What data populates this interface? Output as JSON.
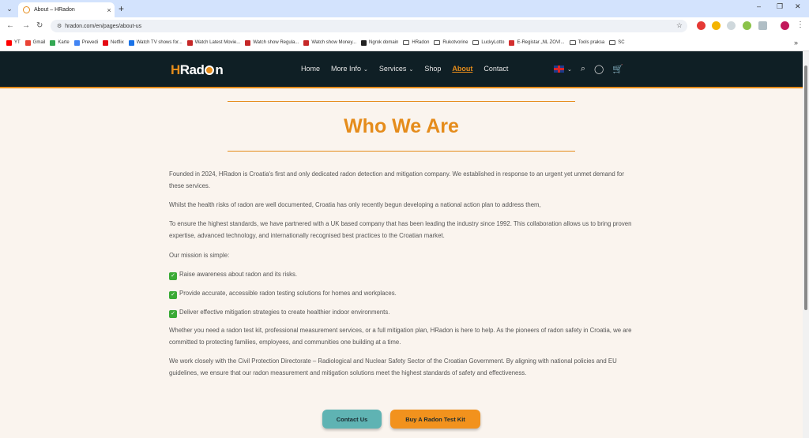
{
  "browser": {
    "tab_title": "About – HRadon",
    "new_tab": "+",
    "url": "hradon.com/en/pages/about-us",
    "window_controls": [
      "–",
      "❐",
      "✕"
    ],
    "nav": {
      "back": "←",
      "forward": "→",
      "reload": "↻"
    },
    "bookmarks": [
      {
        "label": "YT",
        "color": "#ff0000",
        "kind": "icon"
      },
      {
        "label": "Gmail",
        "color": "#ea4335",
        "kind": "icon"
      },
      {
        "label": "Karte",
        "color": "#34a853",
        "kind": "icon"
      },
      {
        "label": "Prevedi",
        "color": "#4285f4",
        "kind": "icon"
      },
      {
        "label": "Netflix",
        "color": "#e50914",
        "kind": "icon"
      },
      {
        "label": "Watch TV shows for...",
        "color": "#1a73e8",
        "kind": "icon"
      },
      {
        "label": "Watch Latest Movie...",
        "color": "#c62828",
        "kind": "icon"
      },
      {
        "label": "Watch show Regula...",
        "color": "#c62828",
        "kind": "icon"
      },
      {
        "label": "Watch show Money...",
        "color": "#c62828",
        "kind": "icon"
      },
      {
        "label": "Ngrok domain",
        "color": "#222222",
        "kind": "icon"
      },
      {
        "label": "HRadon",
        "color": "",
        "kind": "folder"
      },
      {
        "label": "Rukotvorine",
        "color": "",
        "kind": "folder"
      },
      {
        "label": "LuckyLotto",
        "color": "",
        "kind": "folder"
      },
      {
        "label": "E-Registar „NL ZOVI...",
        "color": "#d32f2f",
        "kind": "icon"
      },
      {
        "label": "Tools praksa",
        "color": "",
        "kind": "folder"
      },
      {
        "label": "SC",
        "color": "",
        "kind": "folder"
      }
    ],
    "bookmarks_more": "»"
  },
  "site": {
    "logo": {
      "h": "H",
      "r": "Rad",
      "rest": "n"
    },
    "nav": [
      {
        "label": "Home",
        "dropdown": false,
        "active": false
      },
      {
        "label": "More Info",
        "dropdown": true,
        "active": false
      },
      {
        "label": "Services",
        "dropdown": true,
        "active": false
      },
      {
        "label": "Shop",
        "dropdown": false,
        "active": false
      },
      {
        "label": "About",
        "dropdown": false,
        "active": true
      },
      {
        "label": "Contact",
        "dropdown": false,
        "active": false
      }
    ],
    "accent": "#e58c1b",
    "header_bg": "#0f1f25"
  },
  "main": {
    "heading": "Who We Are",
    "paragraphs": [
      "Founded in 2024, HRadon is Croatia's first and only dedicated radon detection and mitigation company. We established in response to an urgent yet unmet demand for these services.",
      "Whilst the health risks of radon are well documented, Croatia has only recently begun developing a national action plan to address them,",
      "To ensure the highest standards, we have partnered with a UK based company that has been leading the industry since 1992. This collaboration allows us to bring proven expertise, advanced technology, and internationally recognised best practices to the Croatian market.",
      "Our mission is simple:"
    ],
    "mission": [
      "Raise awareness about radon and its risks.",
      "Provide accurate, accessible radon testing solutions for homes and workplaces.",
      "Deliver effective mitigation strategies to create healthier indoor environments."
    ],
    "closing": [
      "Whether you need a radon test kit, professional measurement services, or a full mitigation plan, HRadon is here to help. As the pioneers of radon safety in Croatia, we are committed to protecting families, employees, and communities one building at a time.",
      "We work closely with the Civil Protection Directorate – Radiological and Nuclear Safety Sector of the Croatian Government.  By aligning with national policies and EU guidelines, we ensure that our radon measurement and mitigation solutions meet the highest standards of safety and effectiveness."
    ],
    "buttons": {
      "contact": {
        "label": "Contact Us",
        "color": "#5fb3b3"
      },
      "buy": {
        "label": "Buy A Radon Test Kit",
        "color": "#f2921d"
      }
    }
  }
}
